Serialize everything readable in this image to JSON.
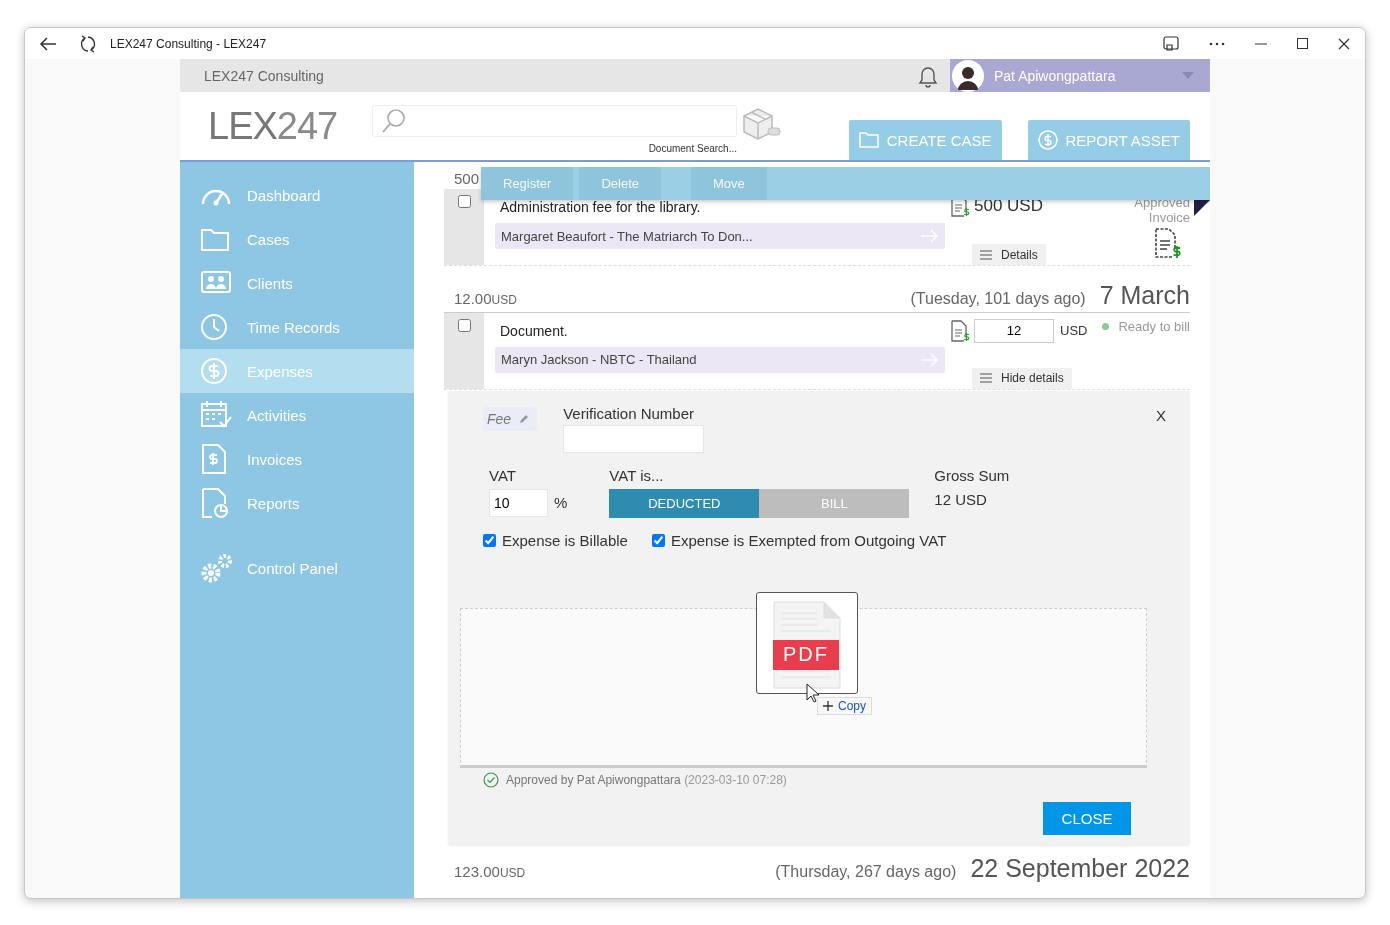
{
  "window": {
    "title": "LEX247 Consulting - LEX247"
  },
  "topbar": {
    "org_name": "LEX247 Consulting",
    "user_name": "Pat Apiwongpattara"
  },
  "header": {
    "logo": "**LEX**247",
    "search_caption": "Document Search...",
    "buttons": [
      "CREATE CASE",
      "REPORT ASSET"
    ]
  },
  "sidebar": {
    "items": [
      {
        "label": "Dashboard",
        "selected": false
      },
      {
        "label": "Cases",
        "selected": false
      },
      {
        "label": "Clients",
        "selected": false
      },
      {
        "label": "Time Records",
        "selected": false
      },
      {
        "label": "Expenses",
        "selected": true
      },
      {
        "label": "Activities",
        "selected": false
      },
      {
        "label": "Invoices",
        "selected": false
      },
      {
        "label": "Reports",
        "selected": false
      },
      {
        "label": "Control Panel",
        "selected": false
      }
    ]
  },
  "toolbar": {
    "buttons": [
      {
        "label": "Register",
        "disabled": true
      },
      {
        "label": "Delete",
        "disabled": true
      },
      {
        "label": "Move",
        "disabled": true
      }
    ]
  },
  "groups": [
    {
      "amount": "500",
      "entries": [
        {
          "checked": false,
          "description": "Administration fee for the library.",
          "matter": "Margaret Beaufort - The Matriarch To Don...",
          "amount": {
            "kind": "text",
            "value": "500 USD"
          },
          "status": [
            "Approved",
            "Invoice"
          ],
          "details_button": "Details"
        }
      ]
    },
    {
      "amount": "12.00",
      "currency": "USD",
      "day": "(Tuesday, 101 days ago)",
      "date": "7 March",
      "entries": [
        {
          "checked": false,
          "description": "Document.",
          "matter": "Maryn Jackson - NBTC - Thailand",
          "amount": {
            "kind": "input",
            "value": "12",
            "currency": "USD"
          },
          "status": [
            "Ready to bill"
          ],
          "color": "#8fc98f",
          "details_button": "Hide details",
          "details": {
            "category": "Fee",
            "verification_label": "Verification Number",
            "close_x": "X",
            "vat_label": "VAT",
            "vat_value": "10",
            "vat_unit": "%",
            "vat_is_label": "VAT is...",
            "vat_options": [
              {
                "label": "DEDUCTED",
                "selected": true
              },
              {
                "label": "BILL",
                "selected": false
              }
            ],
            "gross_label": "Gross Sum",
            "gross_value": "12 USD",
            "checkboxes": [
              {
                "label": "Expense is Billable",
                "checked": true
              },
              {
                "label": "Expense is Exempted from Outgoing VAT",
                "checked": true
              }
            ],
            "attachment": {
              "label": "PDF",
              "tooltip": "Copy"
            },
            "approval": "Approved by Pat Apiwongpattara",
            "approval_time": "(2023-03-10 07:28)",
            "close_button": "CLOSE"
          }
        }
      ]
    },
    {
      "amount": "123.00",
      "currency": "USD",
      "day": "(Thursday, 267 days ago)",
      "date": "22 September 2022"
    }
  ]
}
